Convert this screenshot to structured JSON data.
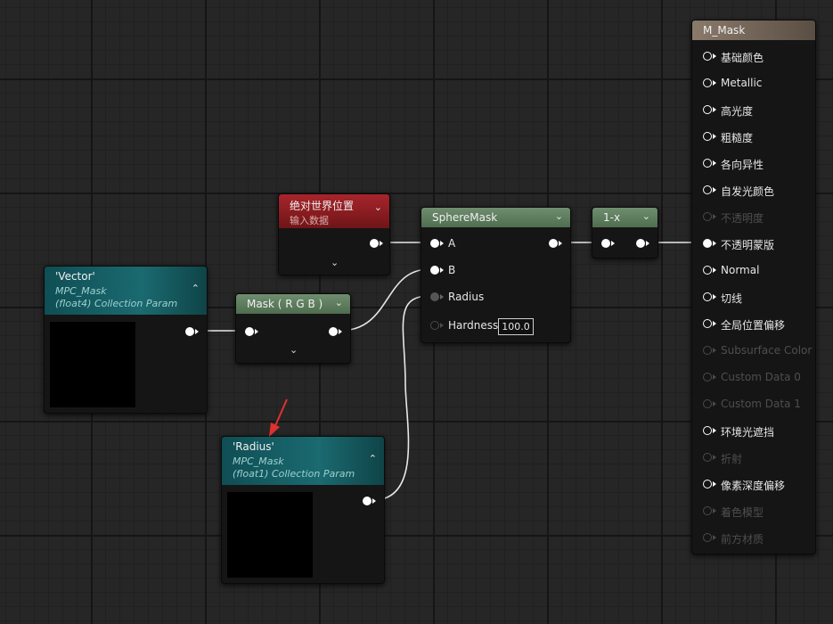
{
  "nodes": {
    "world_pos": {
      "title": "绝对世界位置",
      "subtitle": "输入数据",
      "expand": "⌄",
      "collapse": "⌄"
    },
    "vector": {
      "title": "'Vector'",
      "line1": "MPC_Mask",
      "line2": "(float4) Collection Param",
      "collapse": "⌃"
    },
    "mask": {
      "title": "Mask ( R G B )",
      "collapse": "⌄",
      "expand": "⌄"
    },
    "sphere": {
      "title": "SphereMask",
      "collapse": "⌄",
      "pin_a": "A",
      "pin_b": "B",
      "pin_radius": "Radius",
      "pin_hardness": "Hardness",
      "hardness_value": "100.0"
    },
    "oneminus": {
      "title": "1-x",
      "collapse": "⌄"
    },
    "radius": {
      "title": "'Radius'",
      "line1": "MPC_Mask",
      "line2": "(float1) Collection Param",
      "collapse": "⌃"
    },
    "material": {
      "title": "M_Mask",
      "pins": [
        {
          "label": "基础颜色",
          "enabled": true
        },
        {
          "label": "Metallic",
          "enabled": true
        },
        {
          "label": "高光度",
          "enabled": true
        },
        {
          "label": "粗糙度",
          "enabled": true
        },
        {
          "label": "各向异性",
          "enabled": true
        },
        {
          "label": "自发光颜色",
          "enabled": true
        },
        {
          "label": "不透明度",
          "enabled": false
        },
        {
          "label": "不透明蒙版",
          "enabled": true,
          "connected": true
        },
        {
          "label": "Normal",
          "enabled": true
        },
        {
          "label": "切线",
          "enabled": true
        },
        {
          "label": "全局位置偏移",
          "enabled": true
        },
        {
          "label": "Subsurface Color",
          "enabled": false
        },
        {
          "label": "Custom Data 0",
          "enabled": false
        },
        {
          "label": "Custom Data 1",
          "enabled": false
        },
        {
          "label": "环境光遮挡",
          "enabled": true
        },
        {
          "label": "折射",
          "enabled": false
        },
        {
          "label": "像素深度偏移",
          "enabled": true
        },
        {
          "label": "着色模型",
          "enabled": false
        },
        {
          "label": "前方材质",
          "enabled": false
        }
      ]
    }
  },
  "colors": {
    "teal": "#1a6a70",
    "green": "#5c7a5c",
    "red": "#a8252b",
    "wire": "#ffffff",
    "annotation_arrow": "#e03030"
  }
}
